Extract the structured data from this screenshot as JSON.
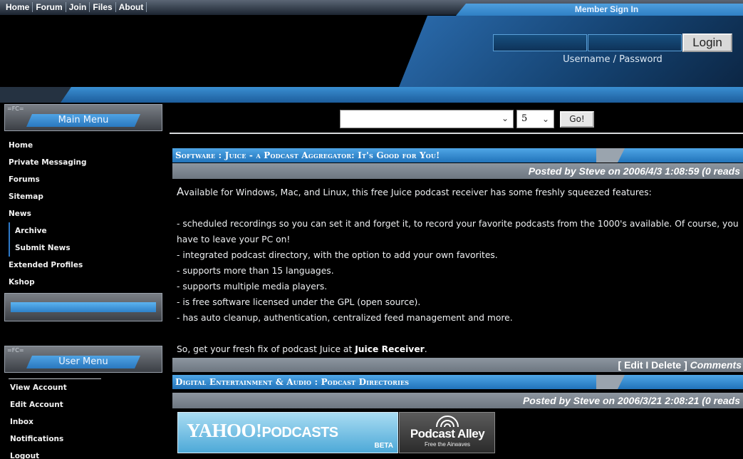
{
  "nav": {
    "links": [
      "Home",
      "Forum",
      "Join",
      "Files",
      "About"
    ]
  },
  "login": {
    "title": "Member Sign In",
    "button": "Login",
    "caption": "Username / Password"
  },
  "content_filter": {
    "topic_value": "",
    "count_value": "5",
    "go_label": "Go!"
  },
  "main_menu": {
    "tag": "=FC=",
    "title": "Main Menu",
    "items": [
      "Home",
      "Private Messaging",
      "Forums",
      "Sitemap",
      "News"
    ],
    "news_subitems": [
      "Archive",
      "Submit News"
    ],
    "more_items": [
      "Extended Profiles",
      "Kshop"
    ]
  },
  "user_menu": {
    "tag": "=FC=",
    "title": "User Menu",
    "items": [
      "View Account",
      "Edit Account",
      "Inbox",
      "Notifications",
      "Logout"
    ]
  },
  "stories": [
    {
      "title": "Software : Juice - a Podcast Aggregator: It's Good for You!",
      "posted": "Posted by Steve on 2006/4/3 1:08:59 (0 reads",
      "intro_initial": "A",
      "intro_rest": "vailable for Windows, Mac, and Linux, this free Juice podcast receiver has some freshly squeezed features:",
      "bullets": [
        "- scheduled recordings so you can set it and forget it, to record your favorite podcasts from the 1000's available. Of course, you have to leave your PC on!",
        "- integrated podcast directory, with the option to add your own favorites.",
        "- supports more than 15 languages.",
        "- supports multiple media players.",
        "- is free software licensed under the GPL (open source).",
        "- has auto cleanup, authentication, centralized feed management and more."
      ],
      "closing_prefix": "So, get your fresh fix of podcast Juice at ",
      "closing_link": "Juice Receiver",
      "closing_suffix": ".",
      "actions_text": "[ Edit I Delete ]",
      "comments_label": "Comments"
    },
    {
      "title": "Digital Entertainment & Audio : Podcast Directories",
      "posted": "Posted by Steve on 2006/3/21 2:08:21 (0 reads"
    }
  ],
  "logos": {
    "yahoo_main": "YAHOO!",
    "yahoo_sub": "PODCASTS",
    "yahoo_beta": "BETA",
    "alley_name": "Podcast Alley",
    "alley_tagline": "Free the Airwaves"
  },
  "colors": {
    "accent_blue": "#2f7fc4",
    "title_bar_blue": "#4fa6e6",
    "meta_bar_grey": "#7d8690",
    "background": "#000000"
  }
}
